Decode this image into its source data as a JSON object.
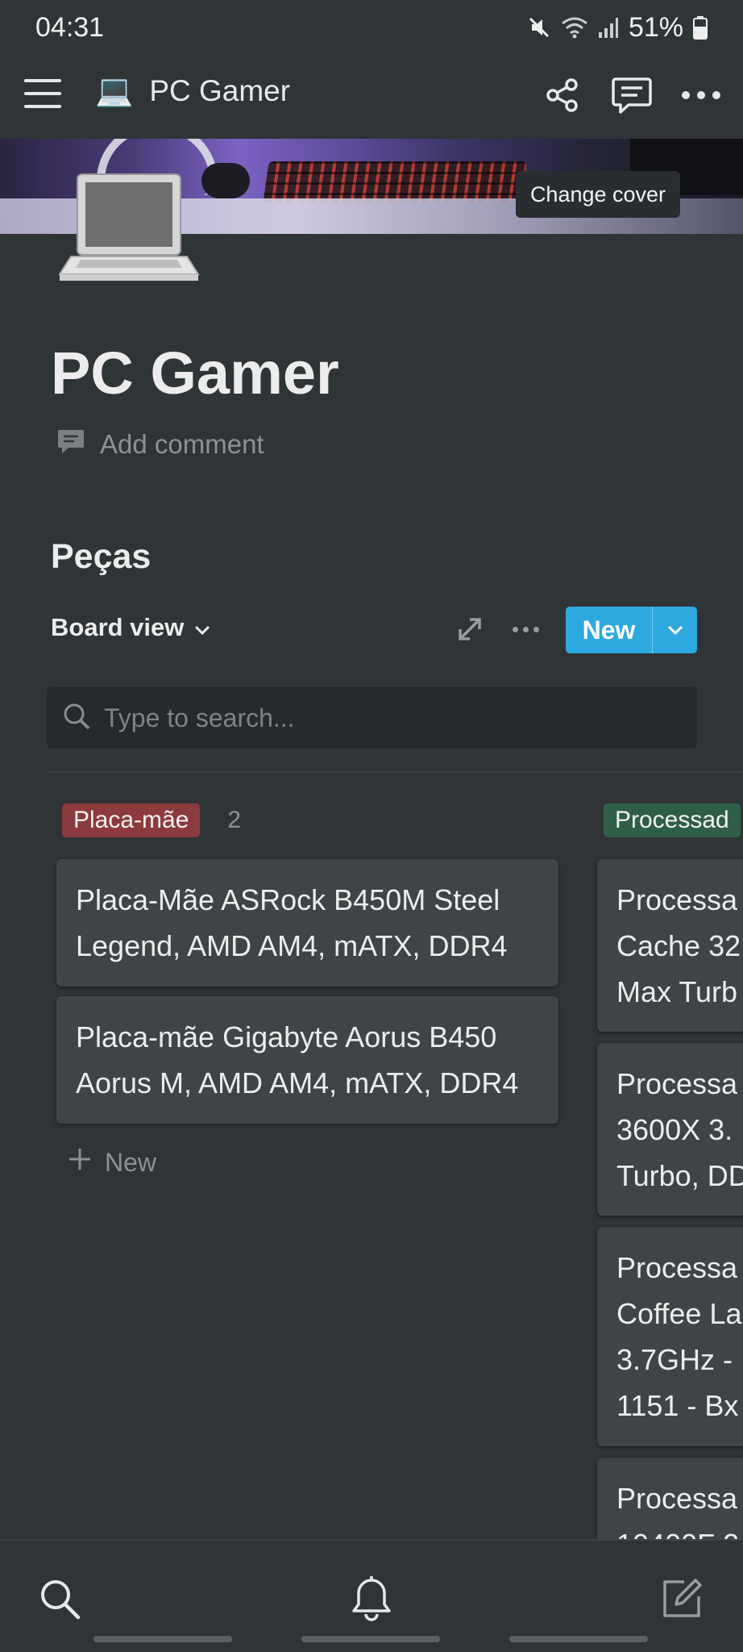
{
  "status_bar": {
    "time": "04:31",
    "battery": "51%"
  },
  "topnav": {
    "page_emoji": "💻",
    "page_title": "PC Gamer",
    "icons": [
      "menu-icon",
      "share-icon",
      "comments-icon",
      "more-icon"
    ]
  },
  "cover": {
    "change_label": "Change cover"
  },
  "page": {
    "icon": "laptop-emoji",
    "title": "PC Gamer",
    "add_comment": "Add comment",
    "section_title": "Peças"
  },
  "view": {
    "name": "Board view",
    "new_label": "New",
    "search_placeholder": "Type to search..."
  },
  "board": {
    "columns": [
      {
        "tag": "Placa-mãe",
        "color": "#8c3a3e",
        "count": "2",
        "cards": [
          {
            "line1": "Placa-Mãe ASRock B450M Steel",
            "line2": "Legend, AMD AM4, mATX, DDR4"
          },
          {
            "line1": "Placa-mãe Gigabyte Aorus B450",
            "line2": "Aorus M, AMD AM4, mATX, DDR4"
          }
        ],
        "new_label": "New"
      },
      {
        "tag": "Processad",
        "color": "#2f5e47",
        "cards": [
          {
            "lines": [
              "Processa",
              "Cache 32",
              "Max Turb"
            ]
          },
          {
            "lines": [
              "Processa",
              "3600X 3.",
              "Turbo, DD"
            ]
          },
          {
            "lines": [
              "Processa",
              "Coffee La",
              "3.7GHz -",
              "1151 - Bx"
            ]
          },
          {
            "lines": [
              "Processa",
              "10400F 2"
            ]
          }
        ]
      }
    ]
  },
  "bottom_nav": {
    "icons": [
      "search-icon",
      "bell-icon",
      "compose-icon"
    ]
  }
}
